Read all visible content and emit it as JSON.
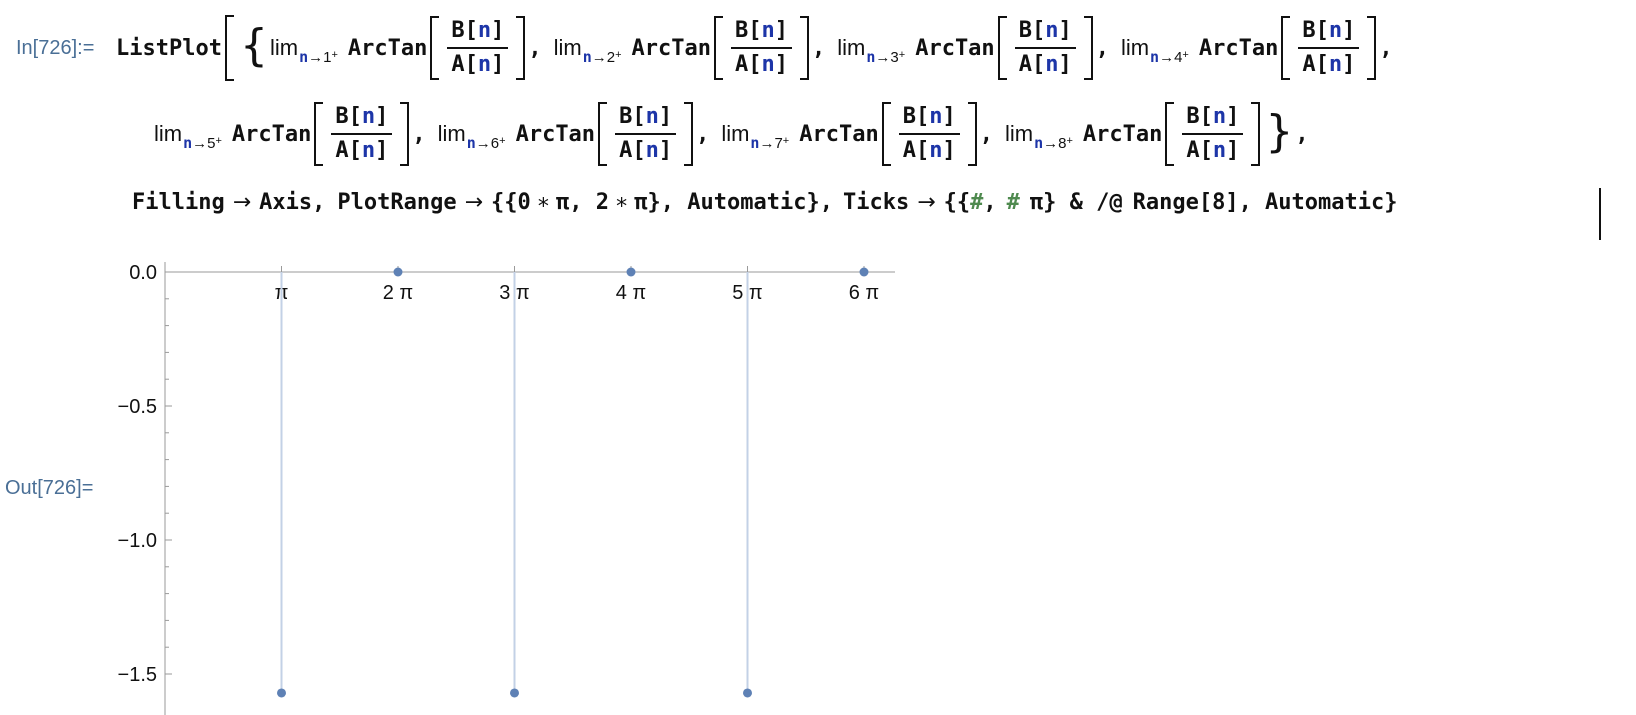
{
  "in_label": "In[726]:=",
  "out_label": "Out[726]=",
  "code": {
    "fn": "ListPlot",
    "limit_word": "lim",
    "arctan": "ArcTan",
    "frac_num_head": "B",
    "frac_den_head": "A",
    "var": "n",
    "limits": [
      {
        "point": "1"
      },
      {
        "point": "2"
      },
      {
        "point": "3"
      },
      {
        "point": "4"
      },
      {
        "point": "5"
      },
      {
        "point": "6"
      },
      {
        "point": "7"
      },
      {
        "point": "8"
      }
    ],
    "filling": "Filling",
    "axis": "Axis",
    "plotrange": "PlotRange",
    "plotrange_val_a": "{{0",
    "plotrange_val_b": "π, 2",
    "plotrange_val_c": "π}, Automatic},",
    "ticks": "Ticks",
    "ticks_val_a": "{{",
    "ticks_hash": "#",
    "ticks_val_b": "π} & /@",
    "range": "Range[8], Automatic}"
  },
  "chart_data": {
    "type": "scatter",
    "filling": "axis",
    "x_tick_labels": [
      "π",
      "2 π",
      "3 π",
      "4 π",
      "5 π",
      "6 π"
    ],
    "y_tick_labels": [
      "0.0",
      "−0.5",
      "−1.0",
      "−1.5"
    ],
    "y_ticks": [
      0,
      -0.5,
      -1.0,
      -1.5
    ],
    "x_ticks": [
      1,
      2,
      3,
      4,
      5,
      6
    ],
    "x": [
      1,
      2,
      3,
      4,
      5,
      6
    ],
    "y": [
      -1.5708,
      0,
      -1.5708,
      0,
      -1.5708,
      0
    ],
    "xlim": [
      0,
      6.3
    ],
    "ylim": [
      -1.65,
      0
    ],
    "marker_color": "#5e81b5",
    "fill_color": "#c3d1e6"
  }
}
